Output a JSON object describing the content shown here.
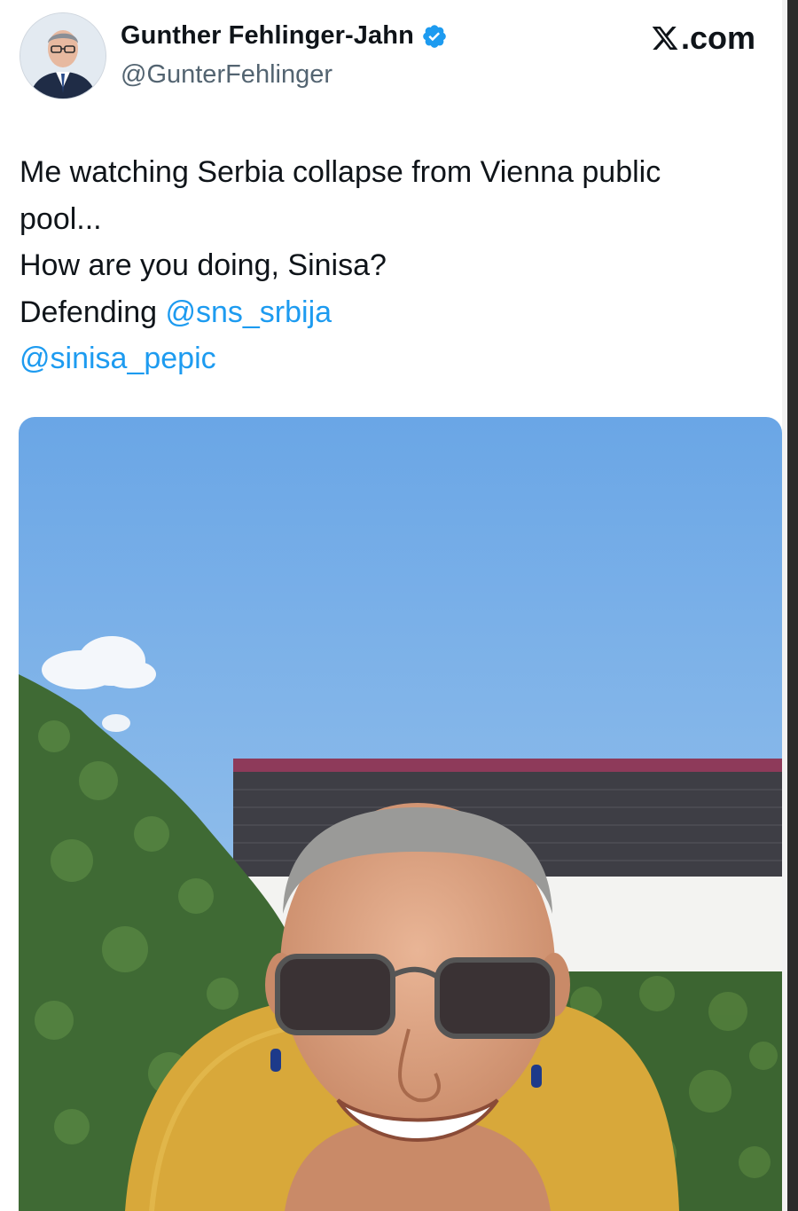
{
  "author": {
    "display_name": "Gunther Fehlinger-Jahn",
    "handle": "@GunterFehlinger",
    "verified": true,
    "verified_icon": "verified-badge-icon"
  },
  "brand": {
    "x_logo": "X",
    "suffix": ".com"
  },
  "tweet": {
    "line1": "Me watching Serbia collapse from Vienna public",
    "line2": "pool...",
    "line3": "How are you doing, Sinisa?",
    "line4_prefix": "Defending ",
    "mention1": "@sns_srbija",
    "mention2": "@sinisa_pepic"
  },
  "colors": {
    "link": "#1d9bf0",
    "verified": "#1d9bf0",
    "text": "#0f1419",
    "secondary": "#536471"
  },
  "media": {
    "type": "photo"
  }
}
